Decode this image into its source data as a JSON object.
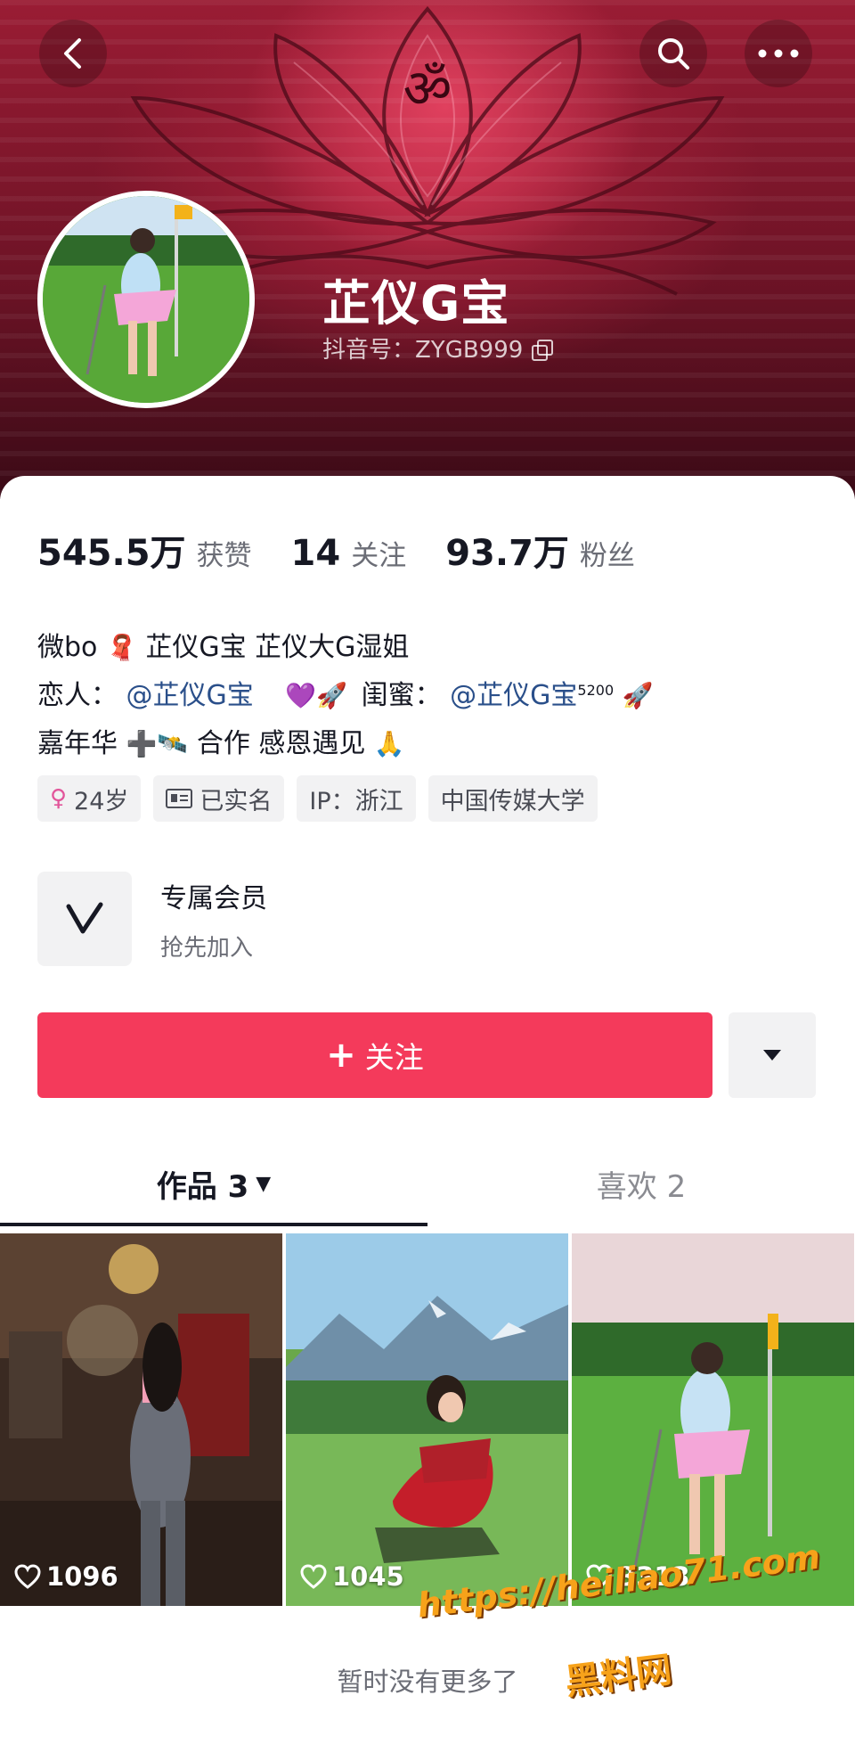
{
  "header": {
    "back_icon": "back-arrow-icon",
    "search_icon": "search-icon",
    "more_icon": "more-dots-icon"
  },
  "profile": {
    "name": "芷仪G宝",
    "douyin_id": "抖音号：ZYGB999"
  },
  "stats": [
    {
      "value": "545.5万",
      "label": "获赞"
    },
    {
      "value": "14",
      "label": "关注"
    },
    {
      "value": "93.7万",
      "label": "粉丝"
    }
  ],
  "bio": {
    "line1_a": "微bo",
    "line1_emoji": "🧣",
    "line1_b": "芷仪G宝  芷仪大G湿姐",
    "line2_lover_label": "恋人：",
    "line2_lover_mention": "@芷仪G宝",
    "line2_emoji_a": "💜🚀",
    "line2_bestie_label": "闺蜜：",
    "line2_bestie_mention": "@芷仪G宝",
    "line2_sup": "5200",
    "line2_emoji_b": "🚀",
    "line3_a": "嘉年华",
    "line3_emoji": "➕🛰️",
    "line3_b": "合作   感恩遇见",
    "line3_emoji_b": "🙏"
  },
  "tags": [
    {
      "icon": "female-icon",
      "label": "24岁"
    },
    {
      "icon": "id-card-icon",
      "label": "已实名"
    },
    {
      "icon": "",
      "label": "IP：浙江"
    },
    {
      "icon": "",
      "label": "中国传媒大学"
    }
  ],
  "member": {
    "title": "专属会员",
    "subtitle": "抢先加入"
  },
  "actions": {
    "follow_label": "关注",
    "follow_plus": "+"
  },
  "tabs": [
    {
      "label": "作品 3",
      "active": true
    },
    {
      "label": "喜欢 2",
      "active": false
    }
  ],
  "videos": [
    {
      "likes": "1096"
    },
    {
      "likes": "1045"
    },
    {
      "likes": "3313"
    }
  ],
  "footer_note": "暂时没有更多了",
  "watermark": {
    "url": "https://heiliao71.com",
    "name": "黑料网"
  },
  "colors": {
    "accent": "#f43a5b",
    "mention": "#2a4f8a",
    "banner": "#9a1c34"
  }
}
